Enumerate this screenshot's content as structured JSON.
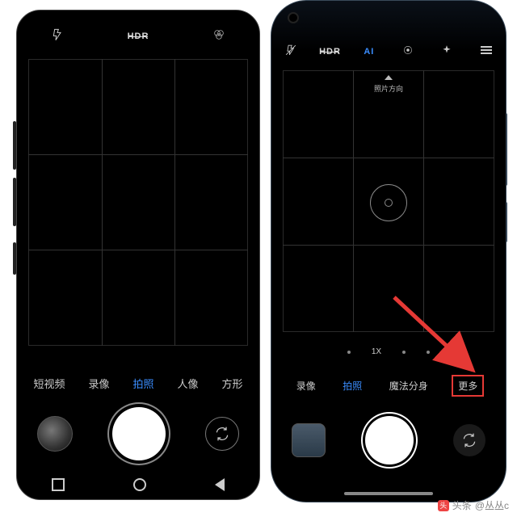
{
  "left_phone": {
    "top_icons": {
      "flash": "⚡",
      "hdr": "HDR",
      "filter": "⚙"
    },
    "modes": [
      {
        "label": "短视频",
        "active": false
      },
      {
        "label": "录像",
        "active": false
      },
      {
        "label": "拍照",
        "active": true
      },
      {
        "label": "人像",
        "active": false
      },
      {
        "label": "方形",
        "active": false
      }
    ],
    "nav": {
      "recents": "□",
      "home": "○",
      "back": "◁"
    }
  },
  "right_phone": {
    "top_icons": {
      "flash": "✱",
      "hdr": "HDR",
      "ai": "AI",
      "target": "◎",
      "sparkle": "✦",
      "menu": "≡"
    },
    "direction_label": "照片方向",
    "zoom": {
      "dots_left": 1,
      "center": "1X",
      "dots_right": 2
    },
    "modes": [
      {
        "label": "录像",
        "active": false
      },
      {
        "label": "拍照",
        "active": true
      },
      {
        "label": "魔法分身",
        "active": false
      },
      {
        "label": "更多",
        "active": false,
        "highlight": true
      }
    ]
  },
  "watermark": {
    "prefix": "头条",
    "user": "@丛丛c"
  }
}
